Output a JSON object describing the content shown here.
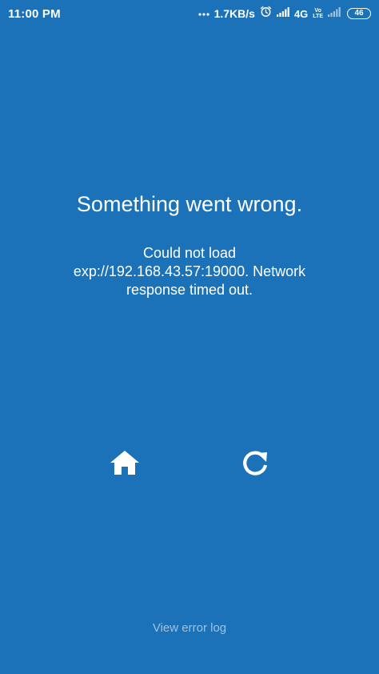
{
  "status_bar": {
    "time": "11:00 PM",
    "network_speed": "1.7KB/s",
    "network_type": "4G",
    "volte_top": "Vo",
    "volte_bottom": "LTE",
    "battery_level": "46",
    "icons": [
      "dots-icon",
      "alarm-icon",
      "signal-icon",
      "signal-icon-2",
      "battery-icon"
    ]
  },
  "error": {
    "title": "Something went wrong.",
    "message": "Could not load exp://192.168.43.57:19000. Network response timed out."
  },
  "actions": {
    "home_icon": "home-icon",
    "reload_icon": "reload-icon"
  },
  "footer": {
    "error_log_label": "View error log"
  },
  "colors": {
    "background": "#1b72b8",
    "text": "#ffffff",
    "link": "#9ec3e2"
  }
}
